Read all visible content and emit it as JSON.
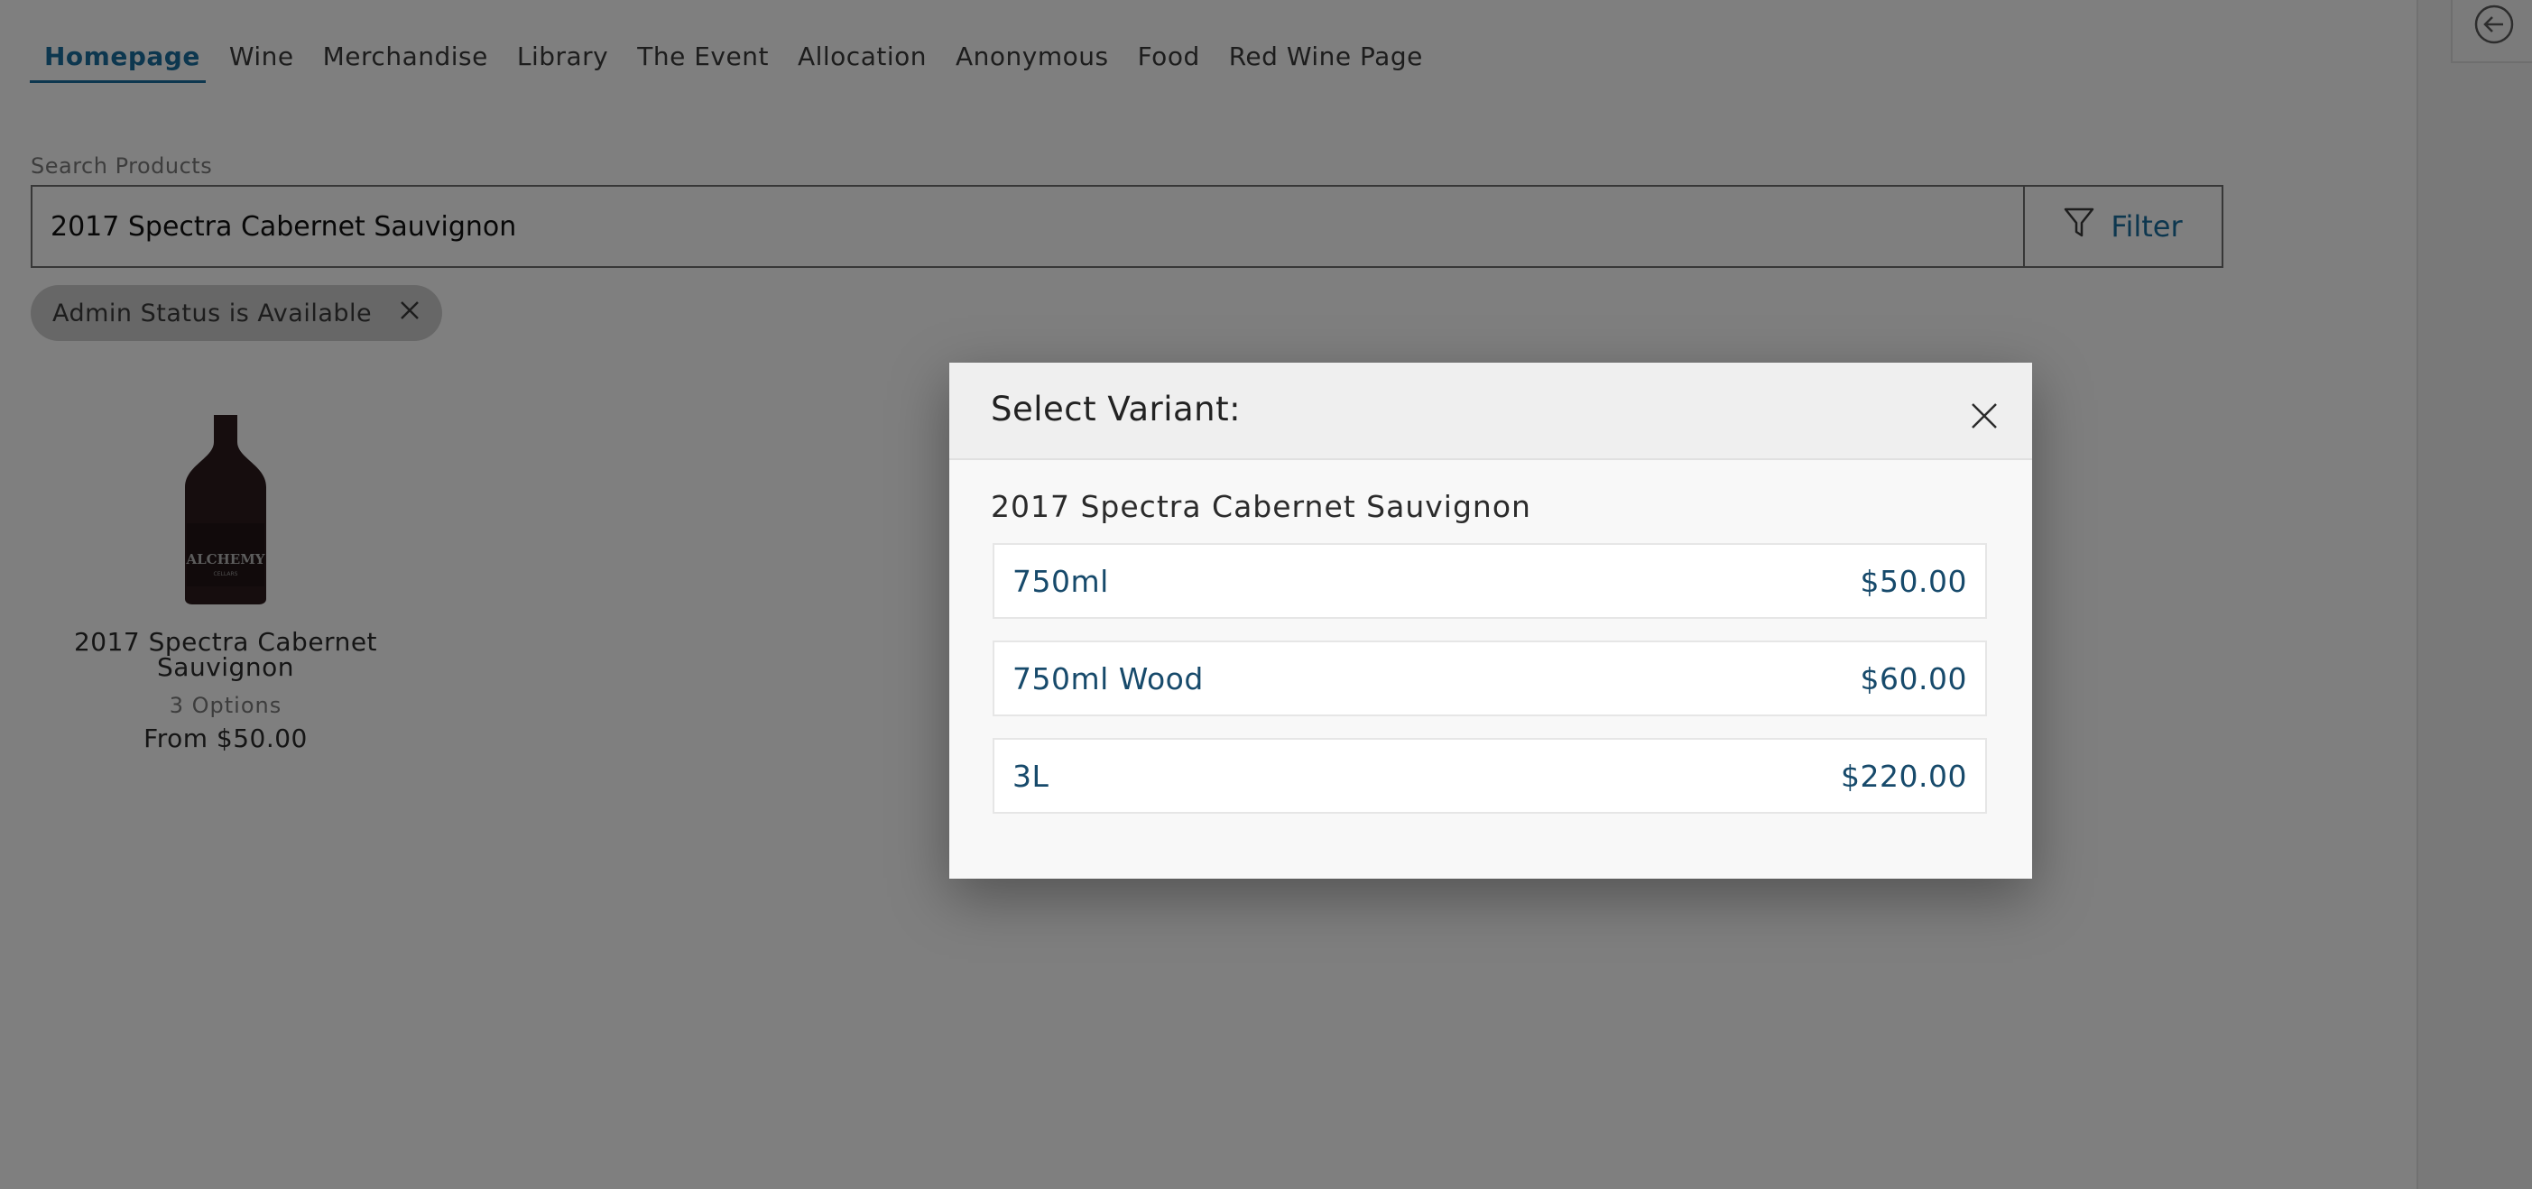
{
  "nav": {
    "tabs": [
      {
        "label": "Homepage"
      },
      {
        "label": "Wine"
      },
      {
        "label": "Merchandise"
      },
      {
        "label": "Library"
      },
      {
        "label": "The Event"
      },
      {
        "label": "Allocation"
      },
      {
        "label": "Anonymous"
      },
      {
        "label": "Food"
      },
      {
        "label": "Red Wine Page"
      }
    ],
    "active": "Homepage"
  },
  "search": {
    "label": "Search Products",
    "value": "2017 Spectra Cabernet Sauvignon",
    "filter_label": "Filter"
  },
  "active_filter_chip": "Admin Status is Available",
  "product": {
    "bottle_brand": "ALCHEMY",
    "bottle_sub": "CELLARS",
    "name_line1": "2017 Spectra Cabernet",
    "name_line2": "Sauvignon",
    "options": "3 Options",
    "price": "From $50.00"
  },
  "modal": {
    "title": "Select Variant:",
    "product_name": "2017 Spectra Cabernet Sauvignon",
    "variants": [
      {
        "label": "750ml",
        "price": "$50.00"
      },
      {
        "label": "750ml Wood",
        "price": "$60.00"
      },
      {
        "label": "3L",
        "price": "$220.00"
      }
    ]
  },
  "icons": {
    "filter": "filter-funnel-icon",
    "chip_close": "close-icon",
    "modal_close": "close-icon",
    "back": "arrow-left-circle-icon"
  },
  "colors": {
    "accent": "#1a6e9e",
    "variant_text": "#174a6b",
    "overlay": "rgba(0,0,0,0.5)"
  }
}
